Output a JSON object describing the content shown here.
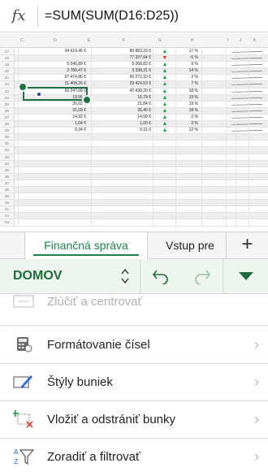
{
  "formula_bar": {
    "fx_label": "fx",
    "formula": "=SUM(SUM(D16:D25))"
  },
  "grid": {
    "columns": [
      "C",
      "D",
      "E",
      "F",
      "G",
      "H",
      "I",
      "J",
      "K"
    ],
    "rows": [
      {
        "num": "17",
        "d": "94 619,46 €",
        "f": "80 883,33 €",
        "trend": "up",
        "pct": "17 %"
      },
      {
        "num": "18",
        "d": "",
        "f": "77 337,84 €",
        "trend": "down",
        "pct": "-5 %"
      },
      {
        "num": "19",
        "d": "5 546,89 €",
        "f": "5 068,82 €",
        "trend": "up",
        "pct": "9 %"
      },
      {
        "num": "20",
        "d": "3 789,47 €",
        "f": "3 338,31 €",
        "trend": "up",
        "pct": "14 %"
      },
      {
        "num": "21",
        "d": "67 474,86 €",
        "f": "66 272,10 €",
        "trend": "up",
        "pct": "2 %"
      },
      {
        "num": "22",
        "d": "31 408,26 €",
        "f": "29 424,53 €",
        "trend": "up",
        "pct": "7 %"
      },
      {
        "num": "23",
        "d": "50 247,68 €",
        "f": "42 438,20 €",
        "trend": "up",
        "pct": "18 %"
      },
      {
        "num": "24",
        "d": "19,96 €",
        "f": "16,79 €",
        "trend": "up",
        "pct": "19 %"
      },
      {
        "num": "25",
        "d": "26,02 €",
        "f": "21,84 €",
        "trend": "up",
        "pct": "19 %"
      },
      {
        "num": "26",
        "d": "31,09 €",
        "f": "26,40 €",
        "trend": "up",
        "pct": "18 %"
      },
      {
        "num": "27",
        "d": "14,92 €",
        "f": "14,59 €",
        "trend": "up",
        "pct": "2 %"
      },
      {
        "num": "28",
        "d": "1,04 €",
        "f": "1,00 €",
        "trend": "up",
        "pct": "3 %"
      },
      {
        "num": "29",
        "d": "0,34 €",
        "f": "0,31 €",
        "trend": "up",
        "pct": "12 %"
      },
      {
        "num": "30"
      },
      {
        "num": "31"
      },
      {
        "num": "32"
      },
      {
        "num": "33"
      },
      {
        "num": "34"
      },
      {
        "num": "35"
      },
      {
        "num": "36"
      },
      {
        "num": "37"
      },
      {
        "num": "38"
      },
      {
        "num": "39"
      },
      {
        "num": "40"
      },
      {
        "num": "41"
      },
      {
        "num": "42"
      },
      {
        "num": "43"
      }
    ],
    "colors": {
      "up": "#22a045",
      "down": "#d63a2a",
      "selection": "#1f7044"
    }
  },
  "sheet_tabs": {
    "active": "Finančná správa",
    "other": "Vstup pre",
    "add_icon": "plus-icon"
  },
  "ribbon": {
    "tab_name": "DOMOV",
    "icons": [
      "updown-icon",
      "undo-icon",
      "redo-icon",
      "collapse-triangle-icon"
    ],
    "accent": "#1e6b3c"
  },
  "commands": {
    "merge": "Zlúčiť a centrovať",
    "number_format": "Formátovanie čísel",
    "cell_styles": "Štýly buniek",
    "insert_delete": "Vložiť a odstrániť bunky",
    "sort_filter": "Zoradiť a filtrovať"
  }
}
